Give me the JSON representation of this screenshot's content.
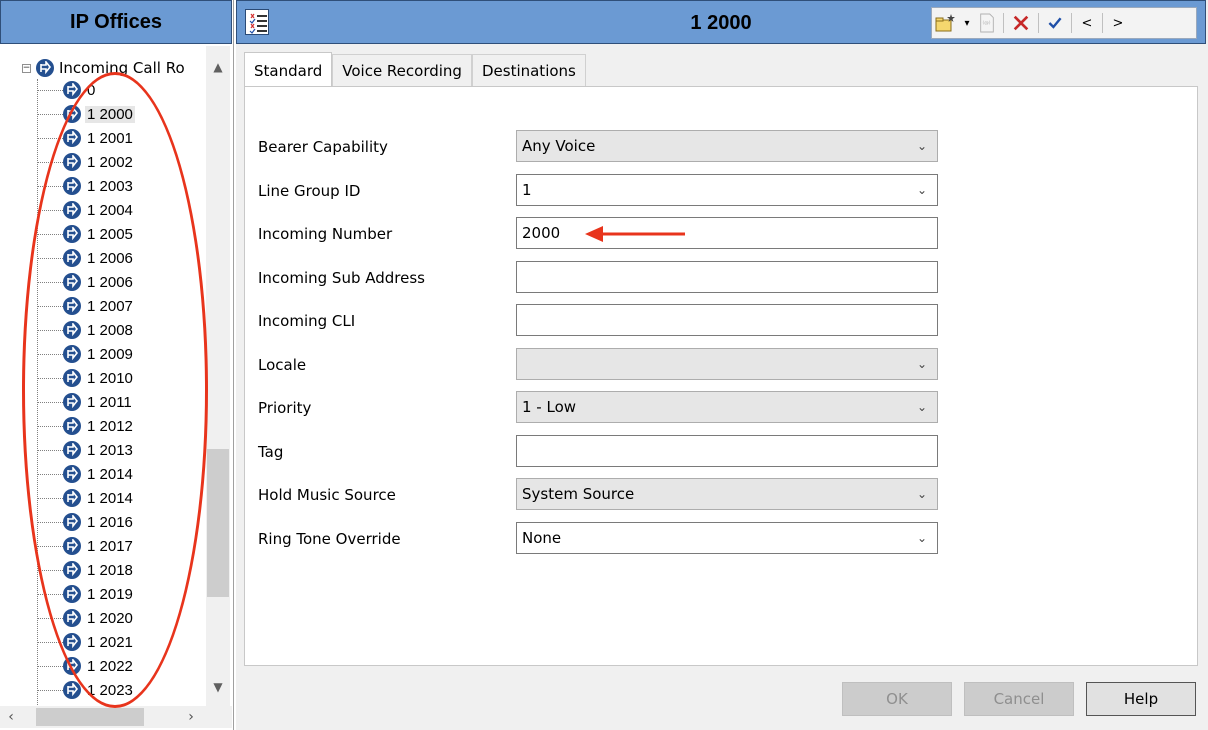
{
  "left_panel": {
    "title": "IP Offices",
    "root_item": "Incoming Call Ro",
    "items": [
      "0",
      "1 2000",
      "1 2001",
      "1 2002",
      "1 2003",
      "1 2004",
      "1 2005",
      "1 2006",
      "1 2006",
      "1 2007",
      "1 2008",
      "1 2009",
      "1 2010",
      "1 2011",
      "1 2012",
      "1 2013",
      "1 2014",
      "1 2014",
      "1 2016",
      "1 2017",
      "1 2018",
      "1 2019",
      "1 2020",
      "1 2021",
      "1 2022",
      "1 2023"
    ],
    "selected_item": "1 2000"
  },
  "detail": {
    "title": "1 2000",
    "tabs": [
      "Standard",
      "Voice Recording",
      "Destinations"
    ],
    "active_tab": "Standard",
    "fields": [
      {
        "label": "Bearer Capability",
        "value": "Any Voice",
        "type": "select"
      },
      {
        "label": "Line Group ID",
        "value": "1",
        "type": "combo"
      },
      {
        "label": "Incoming Number",
        "value": "2000",
        "type": "text"
      },
      {
        "label": "Incoming Sub Address",
        "value": "",
        "type": "text"
      },
      {
        "label": "Incoming CLI",
        "value": "",
        "type": "text"
      },
      {
        "label": "Locale",
        "value": "",
        "type": "select"
      },
      {
        "label": "Priority",
        "value": "1 - Low",
        "type": "select"
      },
      {
        "label": "Tag",
        "value": "",
        "type": "text"
      },
      {
        "label": "Hold Music Source",
        "value": "System Source",
        "type": "select"
      },
      {
        "label": "Ring Tone Override",
        "value": "None",
        "type": "combo"
      }
    ],
    "buttons": {
      "ok": "OK",
      "cancel": "Cancel",
      "help": "Help"
    }
  },
  "toolbar": {
    "icons": [
      "new-record-icon",
      "dropdown-arrow-icon",
      "export-icon",
      "delete-icon",
      "apply-icon",
      "previous-icon",
      "next-icon"
    ],
    "prev_label": "<",
    "next_label": ">"
  },
  "colors": {
    "header_blue": "#6b9ad3",
    "icon_navy": "#244f8f",
    "annotation_red": "#e8341c",
    "delete_red": "#c62828",
    "check_blue": "#1f4fa8"
  }
}
